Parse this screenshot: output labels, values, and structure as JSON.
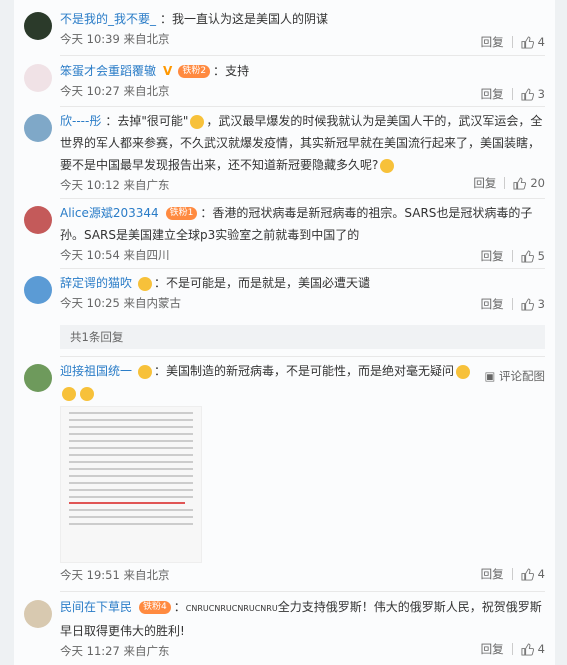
{
  "comments": [
    {
      "name": "不是我的_我不要_",
      "sep": "：",
      "text": "我一直认为这是美国人的阴谋",
      "time": "今天 10:39 来自北京",
      "reply": "回复",
      "likes": "4"
    },
    {
      "name": "笨蛋才会重蹈覆辙",
      "badge": "铁粉2",
      "sep": "：",
      "text": "支持",
      "time": "今天 10:27 来自北京",
      "reply": "回复",
      "likes": "3"
    },
    {
      "name": "欣----彤",
      "sep": "：",
      "text_a": "去掉\"很可能\"",
      "text_b": "，武汉最早爆发的时候我就认为是美国人干的，武汉军运会，全世界的军人都来参赛，不久武汉就爆发疫情，其实新冠早就在美国流行起来了，美国装瞎，要不是中国最早发现报告出来，还不知道新冠要隐藏多久呢?",
      "time": "今天 10:12 来自广东",
      "reply": "回复",
      "likes": "20"
    },
    {
      "name": "Alice源斌203344",
      "badge": "铁粉1",
      "sep": "：",
      "text": "香港的冠状病毒是新冠病毒的祖宗。SARS也是冠状病毒的子孙。SARS是美国建立全球p3实验室之前就毒到中国了的",
      "time": "今天 10:54 来自四川",
      "reply": "回复",
      "likes": "5"
    },
    {
      "name": "辞定谔的猫吹",
      "sep": "：",
      "text": "不是可能是，而是就是，美国必遭天谴",
      "time": "今天 10:25 来自内蒙古",
      "reply": "回复",
      "likes": "3"
    },
    {
      "name": "迎接祖国统一",
      "sep": "：",
      "text": "美国制造的新冠病毒，不是可能性，而是绝对毫无疑问",
      "time": "今天 19:51 来自北京",
      "reply": "回复",
      "likes": "4",
      "share": "评论配图"
    },
    {
      "name": "民间在下草民",
      "badge": "铁粉4",
      "sep": "：",
      "text_small": "CNRUCNRUCNRUCNRU",
      "text": "全力支持俄罗斯！伟大的俄罗斯人民，祝贺俄罗斯早日取得更伟大的胜利!",
      "time": "今天 11:27 来自广东",
      "reply": "回复",
      "likes": "4"
    }
  ],
  "reply_summary": "共1条回复",
  "colors": {
    "name": "#2a7cc7",
    "badge": "#ff8a40"
  }
}
